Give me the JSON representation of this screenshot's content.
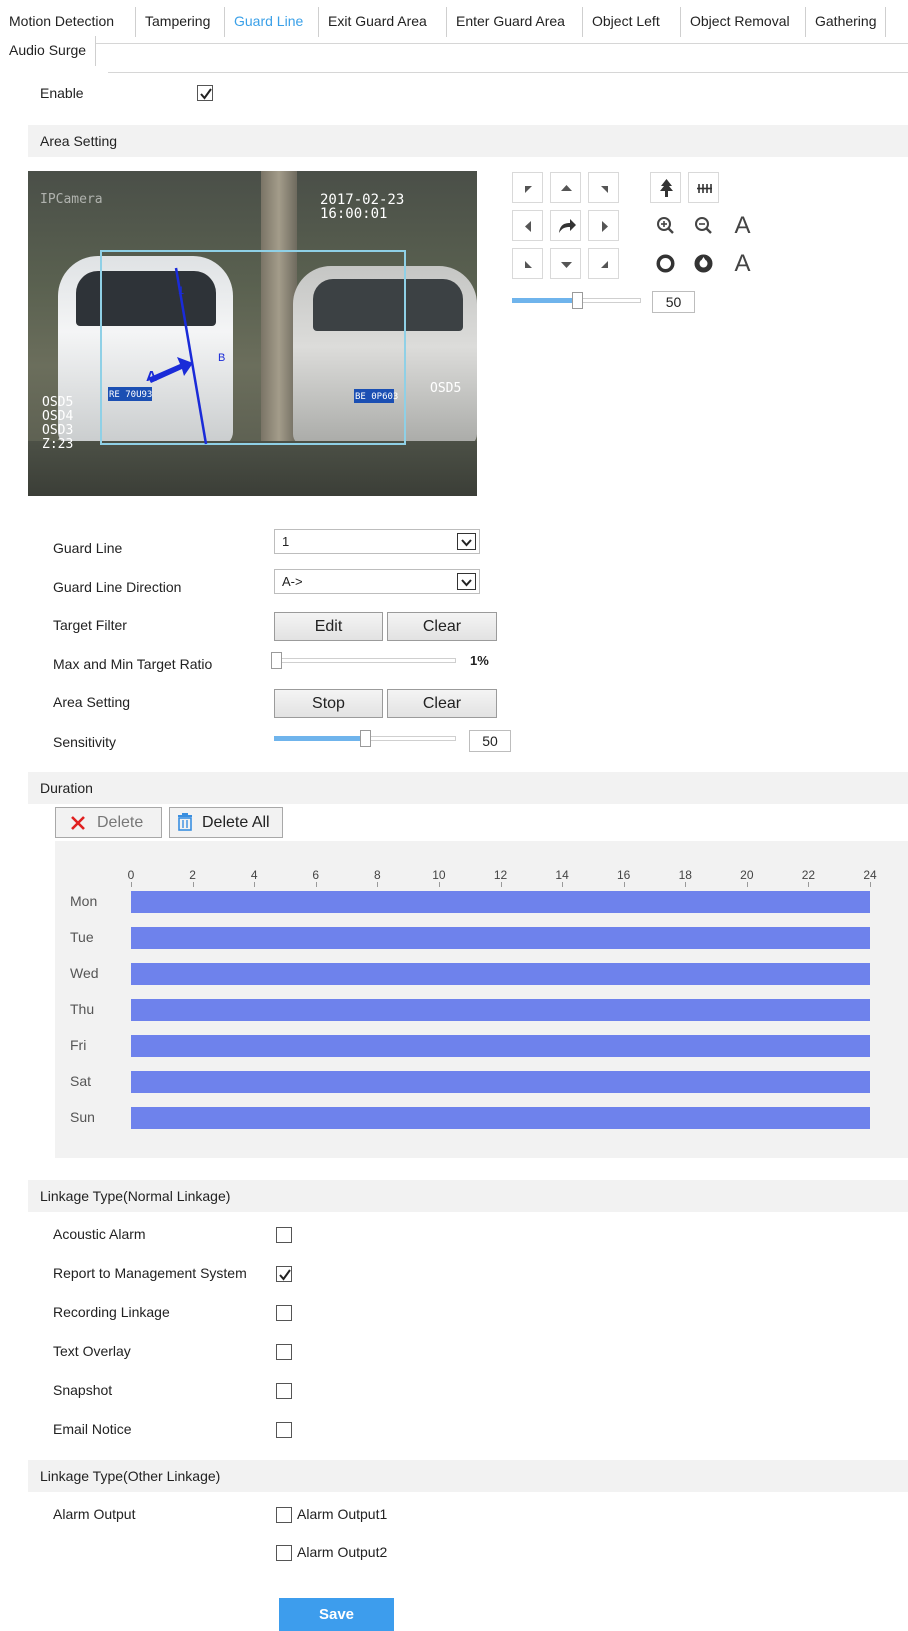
{
  "tabs": {
    "row1": [
      "Motion Detection",
      "Tampering",
      "Guard Line",
      "Exit Guard Area",
      "Enter Guard Area",
      "Object Left",
      "Object Removal",
      "Gathering"
    ],
    "row2": [
      "Audio Surge"
    ],
    "active": "Guard Line"
  },
  "enable": {
    "label": "Enable",
    "checked": true
  },
  "area_setting_section": "Area Setting",
  "video": {
    "osd_camera": "IPCamera",
    "timestamp": "2017-02-23 16:00:01",
    "osd5_right": "OSD5",
    "osd_lines": [
      "OSD5",
      "OSD4",
      "OSD3",
      "Z:23"
    ],
    "plate1": "RE 70U93",
    "plate2": "BE 0P603",
    "line_label_a": "A",
    "line_label_b": "B",
    "line_number": "1"
  },
  "ptz": {
    "icons": [
      "ptz-upleft-icon",
      "ptz-up-icon",
      "ptz-upright-icon",
      "ptz-left-icon",
      "ptz-rotate-icon",
      "ptz-right-icon",
      "ptz-downleft-icon",
      "ptz-down-icon",
      "ptz-downright-icon",
      "focus-near-icon",
      "focus-far-icon",
      "zoom-in-icon",
      "zoom-out-icon",
      "iris-open-icon",
      "iris-close-icon"
    ],
    "text_a1": "A",
    "text_a2": "A",
    "speed_value": "50",
    "speed_fraction": 0.5
  },
  "form": {
    "guard_line_label": "Guard Line",
    "guard_line_value": "1",
    "direction_label": "Guard Line Direction",
    "direction_value": "A->",
    "target_filter_label": "Target Filter",
    "edit_button": "Edit",
    "clear_button": "Clear",
    "ratio_label": "Max and Min Target Ratio",
    "ratio_value": "1%",
    "ratio_fraction": 0.01,
    "area_setting_label": "Area Setting",
    "stop_button": "Stop",
    "clear_button2": "Clear",
    "sensitivity_label": "Sensitivity",
    "sensitivity_value": "50",
    "sensitivity_fraction": 0.5
  },
  "duration": {
    "section": "Duration",
    "delete_button": "Delete",
    "delete_all_button": "Delete All",
    "hours": [
      "0",
      "2",
      "4",
      "6",
      "8",
      "10",
      "12",
      "14",
      "16",
      "18",
      "20",
      "22",
      "24"
    ],
    "days": [
      "Mon",
      "Tue",
      "Wed",
      "Thu",
      "Fri",
      "Sat",
      "Sun"
    ],
    "schedule_color": "#6e82ec",
    "schedule_start_hour": 0,
    "schedule_end_hour": 24
  },
  "linkage_normal": {
    "section": "Linkage Type(Normal Linkage)",
    "items": [
      {
        "label": "Acoustic Alarm",
        "checked": false
      },
      {
        "label": "Report to Management System",
        "checked": true
      },
      {
        "label": "Recording Linkage",
        "checked": false
      },
      {
        "label": "Text Overlay",
        "checked": false
      },
      {
        "label": "Snapshot",
        "checked": false
      },
      {
        "label": "Email Notice",
        "checked": false
      }
    ]
  },
  "linkage_other": {
    "section": "Linkage Type(Other Linkage)",
    "alarm_output_label": "Alarm Output",
    "outputs": [
      {
        "label": "Alarm Output1",
        "checked": false
      },
      {
        "label": "Alarm Output2",
        "checked": false
      }
    ]
  },
  "save_button": "Save",
  "colors": {
    "accent": "#3aa0e8",
    "save_bg": "#3d9ded",
    "slider_fill": "#6fb4ec",
    "section_bg": "#f2f2f2"
  }
}
